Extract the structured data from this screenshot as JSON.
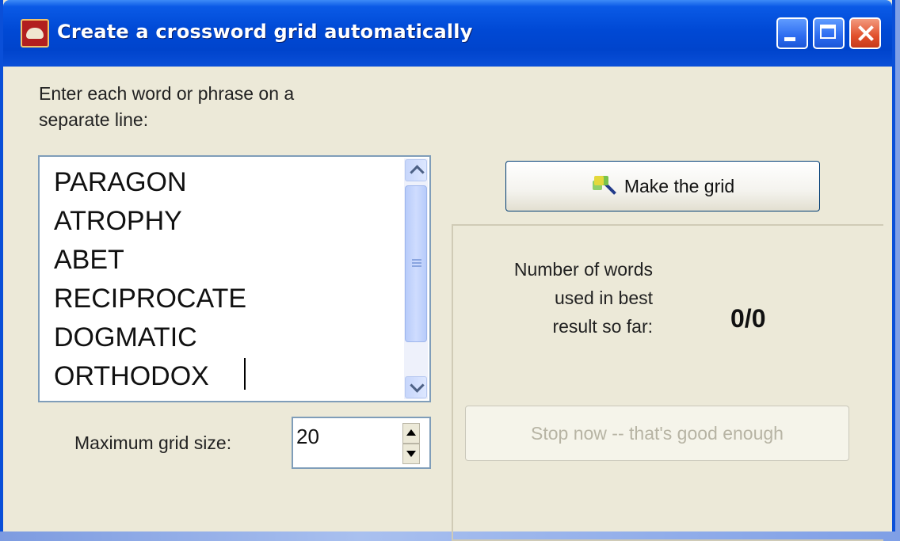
{
  "window": {
    "title": "Create a crossword grid automatically"
  },
  "instructions": {
    "line1": "Enter each word or phrase on a",
    "line2": "separate line:"
  },
  "word_list": {
    "text": "PARAGON\nATROPHY\nABET\nRECIPROCATE\nDOGMATIC\nORTHODOX"
  },
  "grid_size": {
    "label": "Maximum grid size:",
    "value": "20"
  },
  "actions": {
    "make_label": "Make the grid",
    "stop_label": "Stop now -- that's good enough",
    "stop_enabled": false
  },
  "results": {
    "label": "Number of words\nused in best\nresult so far:",
    "count": "0/0"
  },
  "icons": {
    "app": "crossword-app-icon",
    "make": "magic-wand-icon"
  },
  "colors": {
    "titlebar": "#0a4fd8",
    "window_bg": "#ece9d8",
    "close_button": "#e1502c"
  }
}
